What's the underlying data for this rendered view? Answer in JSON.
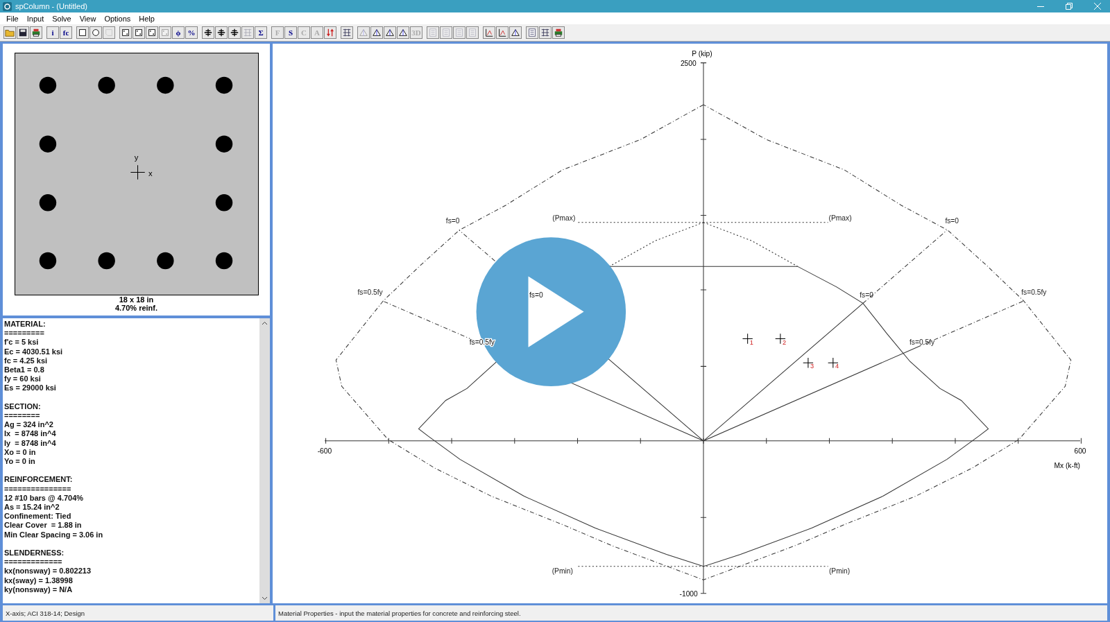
{
  "window": {
    "title": "spColumn - (Untitled)"
  },
  "menu": [
    "File",
    "Input",
    "Solve",
    "View",
    "Options",
    "Help"
  ],
  "toolbar": [
    [
      {
        "kind": "folder",
        "disabled": false
      },
      {
        "kind": "disk",
        "disabled": false
      },
      {
        "kind": "printer",
        "disabled": false
      }
    ],
    [
      {
        "kind": "glyph",
        "label": "i",
        "disabled": false
      },
      {
        "kind": "glyph",
        "label": "fc",
        "disabled": false
      }
    ],
    [
      {
        "kind": "square",
        "disabled": false
      },
      {
        "kind": "circle",
        "disabled": false
      },
      {
        "kind": "polygon",
        "disabled": true
      }
    ],
    [
      {
        "kind": "bars",
        "disabled": false
      },
      {
        "kind": "bars",
        "disabled": false
      },
      {
        "kind": "bars",
        "disabled": false
      },
      {
        "kind": "bars",
        "disabled": true
      },
      {
        "kind": "glyph",
        "label": "ϕ",
        "disabled": false
      },
      {
        "kind": "glyph",
        "label": "%",
        "disabled": false
      }
    ],
    [
      {
        "kind": "cross",
        "disabled": false
      },
      {
        "kind": "cross",
        "disabled": false
      },
      {
        "kind": "cross",
        "disabled": false
      },
      {
        "kind": "grid",
        "disabled": true
      },
      {
        "kind": "glyph",
        "label": "Σ",
        "disabled": false
      }
    ],
    [
      {
        "kind": "glyph",
        "label": "F",
        "disabled": true
      },
      {
        "kind": "glyph",
        "label": "S",
        "disabled": false
      },
      {
        "kind": "glyph",
        "label": "C",
        "disabled": true
      },
      {
        "kind": "glyph",
        "label": "A",
        "disabled": true
      },
      {
        "kind": "arrows",
        "disabled": false
      }
    ],
    [
      {
        "kind": "grid",
        "disabled": false
      }
    ],
    [
      {
        "kind": "view",
        "disabled": true
      },
      {
        "kind": "view",
        "disabled": false
      },
      {
        "kind": "view",
        "disabled": false
      },
      {
        "kind": "view",
        "disabled": false
      },
      {
        "kind": "glyph",
        "label": "3D",
        "disabled": true
      }
    ],
    [
      {
        "kind": "doc",
        "disabled": true
      },
      {
        "kind": "doc",
        "disabled": true
      },
      {
        "kind": "doc",
        "disabled": true
      },
      {
        "kind": "doc",
        "disabled": true
      }
    ],
    [
      {
        "kind": "chart",
        "disabled": false
      },
      {
        "kind": "chart",
        "disabled": false
      },
      {
        "kind": "view",
        "disabled": false
      }
    ],
    [
      {
        "kind": "doc",
        "disabled": false
      },
      {
        "kind": "grid",
        "disabled": false
      },
      {
        "kind": "printer",
        "disabled": false
      }
    ]
  ],
  "section": {
    "axis_y": "y",
    "axis_x": "x",
    "caption": "18 x 18 in",
    "reinforcement": "4.70% reinf."
  },
  "properties": [
    {
      "heading": "MATERIAL:",
      "rule": "=========",
      "lines": [
        "f'c = 5 ksi",
        "Ec = 4030.51 ksi",
        "fc = 4.25 ksi",
        "Beta1 = 0.8",
        "fy = 60 ksi",
        "Es = 29000 ksi"
      ]
    },
    {
      "heading": "SECTION:",
      "rule": "========",
      "lines": [
        "Ag = 324 in^2",
        "Ix  = 8748 in^4",
        "Iy  = 8748 in^4",
        "Xo = 0 in",
        "Yo = 0 in"
      ]
    },
    {
      "heading": "REINFORCEMENT:",
      "rule": "===============",
      "lines": [
        "12 #10 bars @ 4.704%",
        "As = 15.24 in^2",
        "Confinement: Tied",
        "Clear Cover  = 1.88 in",
        "Min Clear Spacing = 3.06 in"
      ]
    },
    {
      "heading": "SLENDERNESS:",
      "rule": "=============",
      "lines": [
        "kx(nonsway) = 0.802213",
        "kx(sway) = 1.38998",
        "ky(nonsway) = N/A"
      ]
    }
  ],
  "diagram": {
    "y_axis_title": "P (kip)",
    "y_max": "2500",
    "y_min": "-1000",
    "x_min": "-600",
    "x_max": "600",
    "x_axis_title": "Mx (k-ft)",
    "annotations": [
      "fs=0",
      "(Pmax)",
      "(Pmax)",
      "fs=0",
      "fs=0.5fy",
      "fs=0",
      "fs=0",
      "fs=0.5fy",
      "fs=0.5fy",
      "fs=0.5fy",
      "(Pmin)",
      "(Pmin)"
    ],
    "load_points": [
      "1",
      "2",
      "3",
      "4"
    ]
  },
  "status_bar": [
    "X-axis; ACI 318-14; Design",
    "Material Properties - input the material properties for concrete and reinforcing steel."
  ]
}
